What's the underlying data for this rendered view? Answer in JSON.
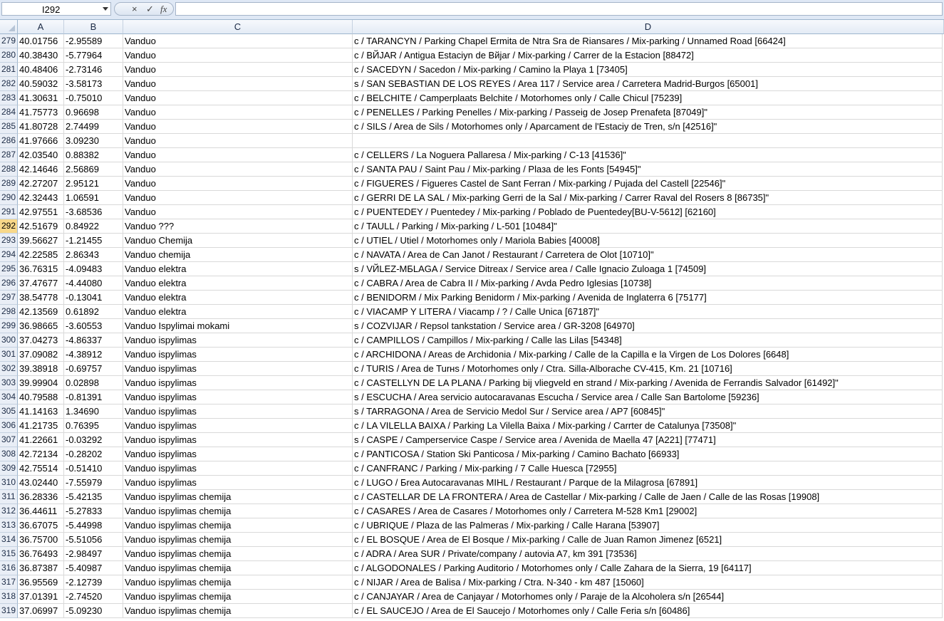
{
  "formula_bar": {
    "name_box": "I292",
    "cancel_icon": "×",
    "enter_icon": "✓",
    "fx_label": "fx",
    "formula": ""
  },
  "columns": [
    "A",
    "B",
    "C",
    "D"
  ],
  "selected_row": "292",
  "rows": [
    {
      "n": "279",
      "a": "40.01756",
      "b": "-2.95589",
      "c": "Vanduo",
      "d": "c / TARANCYN / Parking Chapel Ermita de Ntra Sra de Riansares / Mix-parking / Unnamed Road [66424]"
    },
    {
      "n": "280",
      "a": "40.38430",
      "b": "-5.77964",
      "c": "Vanduo",
      "d": "c / BЙJAR / Antigua Estaciyn de Bйjar / Mix-parking / Carrer de la Estacion [88472]"
    },
    {
      "n": "281",
      "a": "40.48406",
      "b": "-2.73146",
      "c": "Vanduo",
      "d": "c / SACEDYN / Sacedon / Mix-parking / Camino la Playa 1 [73405]"
    },
    {
      "n": "282",
      "a": "40.59032",
      "b": "-3.58173",
      "c": "Vanduo",
      "d": "s / SAN SEBASTIAN DE LOS REYES / Area 117 / Service area / Carretera Madrid-Burgos [65001]"
    },
    {
      "n": "283",
      "a": "41.30631",
      "b": "-0.75010",
      "c": "Vanduo",
      "d": "c / BELCHITE / Camperplaats Belchite / Motorhomes only / Calle Chicul [75239]"
    },
    {
      "n": "284",
      "a": "41.75773",
      "b": "0.96698",
      "c": "Vanduo",
      "d": "c / PENELLES / Parking Penelles / Mix-parking / Passeig de Josep Prenafeta [87049]\""
    },
    {
      "n": "285",
      "a": "41.80728",
      "b": "2.74499",
      "c": "Vanduo",
      "d": "c / SILS / Area de Sils / Motorhomes only / Aparcament de l'Estaciy de Tren, s/n [42516]\""
    },
    {
      "n": "286",
      "a": "41.97666",
      "b": "3.09230",
      "c": "Vanduo",
      "d": ""
    },
    {
      "n": "287",
      "a": "42.03540",
      "b": "0.88382",
      "c": "Vanduo",
      "d": "c / CELLERS / La Noguera Pallaresa / Mix-parking / C-13 [41536]\""
    },
    {
      "n": "288",
      "a": "42.14646",
      "b": "2.56869",
      "c": "Vanduo",
      "d": "c / SANTA PAU / Saint Pau / Mix-parking / Plaзa de les Fonts [54945]\""
    },
    {
      "n": "289",
      "a": "42.27207",
      "b": "2.95121",
      "c": "Vanduo",
      "d": "c / FIGUERES / Figueres Castel de Sant Ferran / Mix-parking / Pujada del Castell [22546]\""
    },
    {
      "n": "290",
      "a": "42.32443",
      "b": "1.06591",
      "c": "Vanduo",
      "d": "c / GERRI DE LA SAL / Mix-parking Gerri de la Sal / Mix-parking / Carrer Raval del Rosers 8 [86735]\""
    },
    {
      "n": "291",
      "a": "42.97551",
      "b": "-3.68536",
      "c": "Vanduo",
      "d": "c / PUENTEDEY / Puentedey / Mix-parking / Poblado de Puentedey[BU-V-5612] [62160]"
    },
    {
      "n": "292",
      "a": "42.51679",
      "b": "0.84922",
      "c": "Vanduo ???",
      "d": "c / TAULL / Parking / Mix-parking / L-501 [10484]\""
    },
    {
      "n": "293",
      "a": "39.56627",
      "b": "-1.21455",
      "c": "Vanduo Chemija",
      "d": "c / UTIEL / Utiel / Motorhomes only / Mariola Babies [40008]"
    },
    {
      "n": "294",
      "a": "42.22585",
      "b": "2.86343",
      "c": "Vanduo chemija",
      "d": "c / NAVATA / Area de Can Janot / Restaurant / Carretera de Olot [10710]\""
    },
    {
      "n": "295",
      "a": "36.76315",
      "b": "-4.09483",
      "c": "Vanduo elektra",
      "d": "s / VЙLEZ-MБLAGA / Service Ditreax / Service area / Calle Ignacio Zuloaga 1 [74509]"
    },
    {
      "n": "296",
      "a": "37.47677",
      "b": "-4.44080",
      "c": "Vanduo elektra",
      "d": "c / CABRA / Area de Cabra II / Mix-parking / Avda Pedro Iglesias [10738]"
    },
    {
      "n": "297",
      "a": "38.54778",
      "b": "-0.13041",
      "c": "Vanduo elektra",
      "d": "c / BENIDORM / Mix Parking Benidorm / Mix-parking / Avenida de Inglaterra 6 [75177]"
    },
    {
      "n": "298",
      "a": "42.13569",
      "b": "0.61892",
      "c": "Vanduo elektra",
      "d": "c / VIACAMP Y LITERA / Viacamp / ? / Calle Unica [67187]\""
    },
    {
      "n": "299",
      "a": "36.98665",
      "b": "-3.60553",
      "c": "Vanduo Ispylimai mokami",
      "d": "s / COZVIJAR / Repsol tankstation / Service area / GR-3208 [64970]"
    },
    {
      "n": "300",
      "a": "37.04273",
      "b": "-4.86337",
      "c": "Vanduo ispylimas",
      "d": "c / CAMPILLOS / Campillos / Mix-parking / Calle las Lilas [54348]"
    },
    {
      "n": "301",
      "a": "37.09082",
      "b": "-4.38912",
      "c": "Vanduo ispylimas",
      "d": "c / ARCHIDONA / Areas de Archidonia / Mix-parking / Calle de la Capilla e la Virgen de Los Dolores [6648]"
    },
    {
      "n": "302",
      "a": "39.38918",
      "b": "-0.69757",
      "c": "Vanduo ispylimas",
      "d": "c / TURIS / Area de Turнs / Motorhomes only / Ctra. Silla-Alborache CV-415, Km. 21 [10716]"
    },
    {
      "n": "303",
      "a": "39.99904",
      "b": "0.02898",
      "c": "Vanduo ispylimas",
      "d": "c / CASTELLYN DE LA PLANA / Parking bij vliegveld en strand / Mix-parking / Avenida de Ferrandis Salvador [61492]\""
    },
    {
      "n": "304",
      "a": "40.79588",
      "b": "-0.81391",
      "c": "Vanduo ispylimas",
      "d": "s / ESCUCHA / Area servicio autocaravanas Escucha / Service area / Calle San Bartolome [59236]"
    },
    {
      "n": "305",
      "a": "41.14163",
      "b": "1.34690",
      "c": "Vanduo ispylimas",
      "d": "s / TARRAGONA / Area de Servicio Medol Sur / Service area / AP7 [60845]\""
    },
    {
      "n": "306",
      "a": "41.21735",
      "b": "0.76395",
      "c": "Vanduo ispylimas",
      "d": "c / LA VILELLA BAIXA / Parking La Vilella Baixa / Mix-parking / Carrter de Catalunya [73508]\""
    },
    {
      "n": "307",
      "a": "41.22661",
      "b": "-0.03292",
      "c": "Vanduo ispylimas",
      "d": "s / CASPE / Camperservice  Caspe / Service area / Avenida de Maella  47 [A221] [77471]"
    },
    {
      "n": "308",
      "a": "42.72134",
      "b": "-0.28202",
      "c": "Vanduo ispylimas",
      "d": "c / PANTICOSA / Station Ski Panticosa / Mix-parking / Camino Bachato [66933]"
    },
    {
      "n": "309",
      "a": "42.75514",
      "b": "-0.51410",
      "c": "Vanduo ispylimas",
      "d": "c / CANFRANC / Parking / Mix-parking / 7 Calle Huesca [72955]"
    },
    {
      "n": "310",
      "a": "43.02440",
      "b": "-7.55979",
      "c": "Vanduo ispylimas",
      "d": "c / LUGO / Бrea Autocaravanas MIHL / Restaurant / Parque de la Milagrosa [67891]"
    },
    {
      "n": "311",
      "a": "36.28336",
      "b": "-5.42135",
      "c": "Vanduo ispylimas chemija",
      "d": "c / CASTELLAR DE LA FRONTERA / Area de Castellar / Mix-parking / Calle de Jaen / Calle de las Rosas [19908]"
    },
    {
      "n": "312",
      "a": "36.44611",
      "b": "-5.27833",
      "c": "Vanduo ispylimas chemija",
      "d": "c / CASARES / Area de Casares / Motorhomes only / Carretera M-528 Km1 [29002]"
    },
    {
      "n": "313",
      "a": "36.67075",
      "b": "-5.44998",
      "c": "Vanduo ispylimas chemija",
      "d": "c / UBRIQUE / Plaza de las Palmeras / Mix-parking / Calle Harana [53907]"
    },
    {
      "n": "314",
      "a": "36.75700",
      "b": "-5.51056",
      "c": "Vanduo ispylimas chemija",
      "d": "c / EL BOSQUE / Area de El Bosque / Mix-parking / Calle de Juan Ramon Jimenez [6521]"
    },
    {
      "n": "315",
      "a": "36.76493",
      "b": "-2.98497",
      "c": "Vanduo ispylimas chemija",
      "d": "c / ADRA / Area SUR / Private/company / autovia A7, km 391 [73536]"
    },
    {
      "n": "316",
      "a": "36.87387",
      "b": "-5.40987",
      "c": "Vanduo ispylimas chemija",
      "d": "c / ALGODONALES / Parking Auditorio / Motorhomes only / Calle Zahara de la Sierra, 19 [64117]"
    },
    {
      "n": "317",
      "a": "36.95569",
      "b": "-2.12739",
      "c": "Vanduo ispylimas chemija",
      "d": "c / NIJAR / Area de Balisa / Mix-parking / Ctra. N-340 - km 487 [15060]"
    },
    {
      "n": "318",
      "a": "37.01391",
      "b": "-2.74520",
      "c": "Vanduo ispylimas chemija",
      "d": "c / CANJAYAR / Area de Canjayar / Motorhomes only / Paraje de la Alcoholera s/n [26544]"
    },
    {
      "n": "319",
      "a": "37.06997",
      "b": "-5.09230",
      "c": "Vanduo ispylimas chemija",
      "d": "c / EL SAUCEJO / Area de El Saucejo / Motorhomes only / Calle Feria s/n [60486]"
    }
  ]
}
